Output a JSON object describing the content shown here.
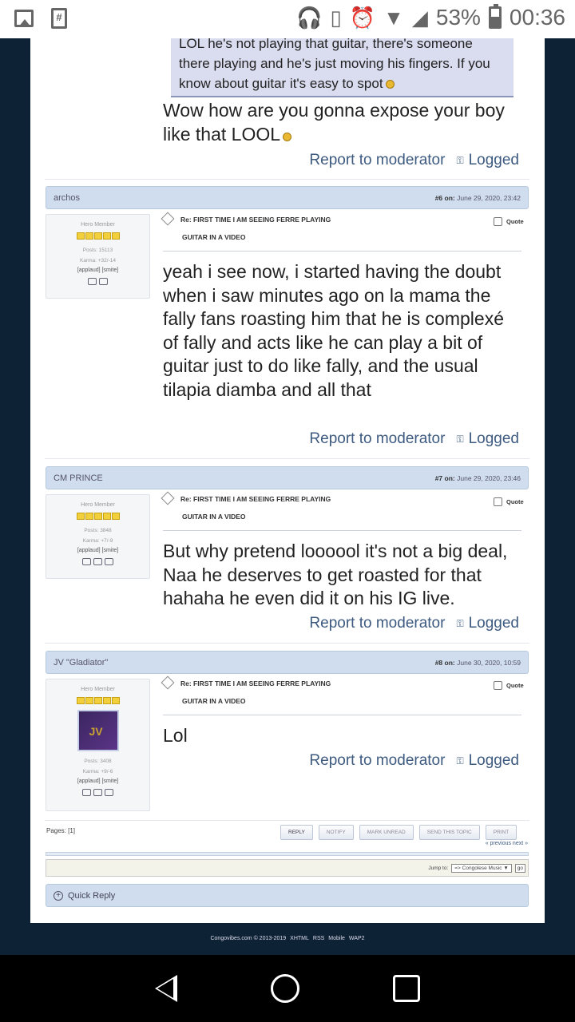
{
  "status_bar": {
    "battery": "53%",
    "time": "00:36"
  },
  "quote_block": {
    "text": "LOL he's not playing that guitar, there's someone there playing and he's just moving his fingers. If you know about guitar it's easy to spot"
  },
  "post5": {
    "message": "Wow how are you gonna expose your boy like that LOOL"
  },
  "actions": {
    "report": "Report to moderator",
    "logged": "Logged"
  },
  "posts": [
    {
      "username": "archos",
      "number": "#6",
      "on": "on:",
      "date": "June 29, 2020, 23:42",
      "rank": "Hero Member",
      "posts": "Posts: 15113",
      "karma": "Karma: +32/-14",
      "applaud": "[applaud] [smite]",
      "subject_1": "Re: FIRST TIME I AM SEEING FERRE PLAYING",
      "subject_2": "GUITAR IN A VIDEO",
      "quote_label": "Quote",
      "message": "yeah i see now, i started having the doubt when i saw minutes ago on la mama the fally fans roasting him that he is complexé of fally and acts like he can play a bit of guitar just to do like fally, and the usual tilapia diamba and all that"
    },
    {
      "username": "CM PRINCE",
      "number": "#7",
      "on": "on:",
      "date": "June 29, 2020, 23:46",
      "rank": "Hero Member",
      "posts": "Posts: 3848",
      "karma": "Karma: +7/-9",
      "applaud": "[applaud] [smite]",
      "subject_1": "Re: FIRST TIME I AM SEEING FERRE PLAYING",
      "subject_2": "GUITAR IN A VIDEO",
      "quote_label": "Quote",
      "message": "But why pretend loooool it's not a big deal, Naa he deserves to get roasted for that hahaha he even did it on his IG live."
    },
    {
      "username": "JV \"Gladiator\"",
      "number": "#8",
      "on": "on:",
      "date": "June 30, 2020, 10:59",
      "rank": "Hero Member",
      "posts": "Posts: 3408",
      "karma": "Karma: +9/-6",
      "applaud": "[applaud] [smite]",
      "subject_1": "Re: FIRST TIME I AM SEEING FERRE PLAYING",
      "subject_2": "GUITAR IN A VIDEO",
      "quote_label": "Quote",
      "message": "Lol"
    }
  ],
  "pages": {
    "label": "Pages: [1]"
  },
  "buttons": {
    "reply": "REPLY",
    "notify": "NOTIFY",
    "mark_unread": "MARK UNREAD",
    "send": "SEND THIS TOPIC",
    "print": "PRINT"
  },
  "prev_next": "« previous next »",
  "jump": {
    "label": "Jump to:",
    "selected": "=> Congolese Music ▼",
    "go": "go"
  },
  "quick_reply": "Quick Reply",
  "credits": {
    "copyright": "Congovibes.com © 2013-2019",
    "xhtml": "XHTML",
    "rss": "RSS",
    "mobile": "Mobile",
    "wap2": "WAP2"
  }
}
